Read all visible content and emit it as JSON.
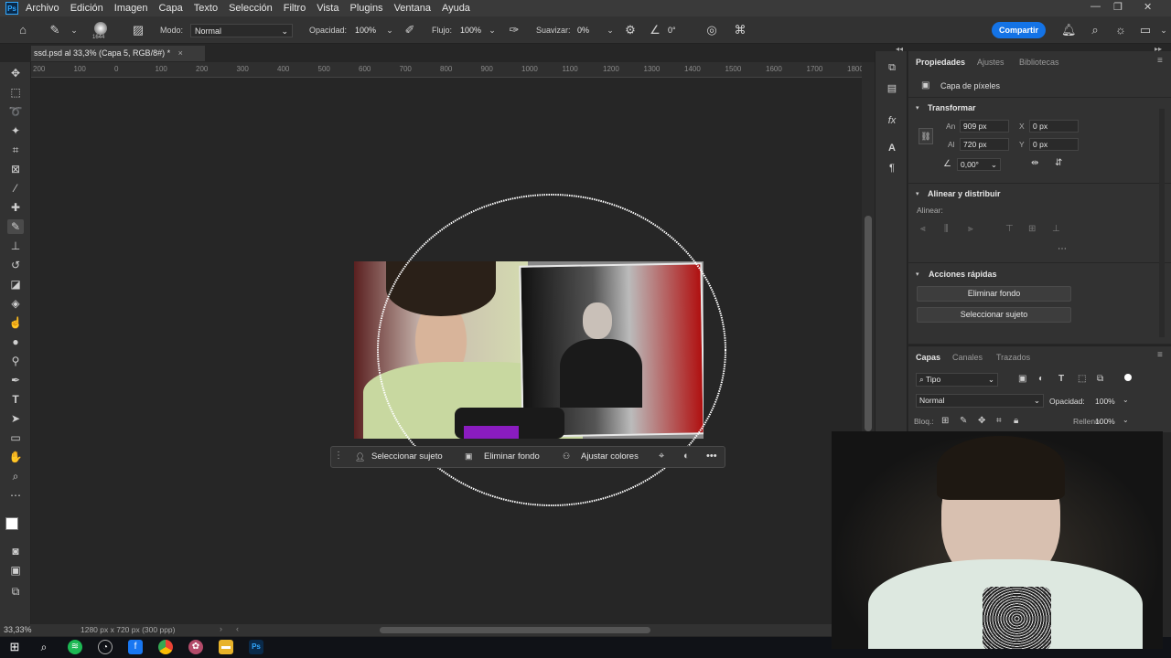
{
  "app": {
    "logo": "Ps"
  },
  "menu": [
    "Archivo",
    "Edición",
    "Imagen",
    "Capa",
    "Texto",
    "Selección",
    "Filtro",
    "Vista",
    "Plugins",
    "Ventana",
    "Ayuda"
  ],
  "window_controls": [
    "—",
    "❐",
    "✕"
  ],
  "options_bar": {
    "brush_size": "1644",
    "mode_label": "Modo:",
    "mode_value": "Normal",
    "opacity_label": "Opacidad:",
    "opacity_value": "100%",
    "flow_label": "Flujo:",
    "flow_value": "100%",
    "smooth_label": "Suavizar:",
    "smooth_value": "0%",
    "angle_value": "0°",
    "share_label": "Compartir"
  },
  "document_tab": {
    "title": "ssd.psd al 33,3% (Capa 5, RGB/8#) *",
    "close": "×"
  },
  "ruler_ticks": [
    "200",
    "100",
    "0",
    "100",
    "200",
    "300",
    "400",
    "500",
    "600",
    "700",
    "800",
    "900",
    "1000",
    "1100",
    "1200",
    "1300",
    "1400",
    "1500",
    "1600",
    "1700",
    "1800"
  ],
  "contextual_bar": {
    "select_subject": "Seleccionar sujeto",
    "remove_bg": "Eliminar fondo",
    "adjust_colors": "Ajustar colores",
    "more": "•••"
  },
  "status_bar": {
    "zoom": "33,33%",
    "doc_info": "1280 px x 720 px (300 ppp)"
  },
  "properties_panel": {
    "tabs": [
      "Propiedades",
      "Ajustes",
      "Bibliotecas"
    ],
    "layer_type": "Capa de píxeles",
    "transform_title": "Transformar",
    "w_label": "An",
    "w_value": "909 px",
    "h_label": "Al",
    "h_value": "720 px",
    "x_label": "X",
    "x_value": "0 px",
    "y_label": "Y",
    "y_value": "0 px",
    "angle_value": "0,00°",
    "align_title": "Alinear y distribuir",
    "align_label": "Alinear:",
    "quick_title": "Acciones rápidas",
    "quick_remove_bg": "Eliminar fondo",
    "quick_select_subject": "Seleccionar sujeto"
  },
  "layers_panel": {
    "tabs": [
      "Capas",
      "Canales",
      "Trazados"
    ],
    "filter_label": "Tipo",
    "blend_mode": "Normal",
    "opacity_label": "Opacidad:",
    "opacity_value": "100%",
    "lock_label": "Bloq.:",
    "fill_label": "Relleno:",
    "fill_value": "100%"
  },
  "colors": {
    "accent": "#1473e6",
    "panel": "#323232",
    "canvas": "#262626"
  }
}
